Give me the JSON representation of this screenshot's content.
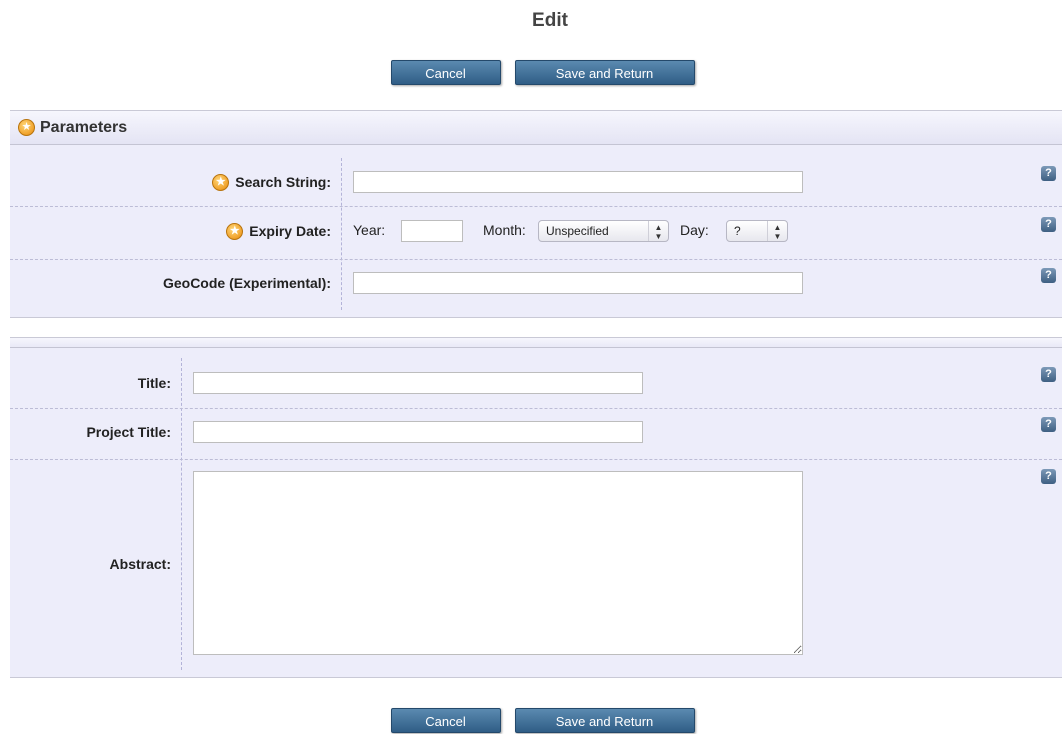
{
  "page": {
    "title": "Edit"
  },
  "buttons": {
    "cancel": "Cancel",
    "save": "Save and Return"
  },
  "parameters": {
    "header": "Parameters",
    "search_string": {
      "label": "Search String:",
      "value": ""
    },
    "expiry_date": {
      "label": "Expiry Date:",
      "year_label": "Year:",
      "year_value": "",
      "month_label": "Month:",
      "month_value": "Unspecified",
      "day_label": "Day:",
      "day_value": "?"
    },
    "geocode": {
      "label": "GeoCode (Experimental):",
      "value": ""
    }
  },
  "details": {
    "title": {
      "label": "Title:",
      "value": ""
    },
    "project_title": {
      "label": "Project Title:",
      "value": ""
    },
    "abstract": {
      "label": "Abstract:",
      "value": ""
    }
  },
  "help": {
    "glyph": "?"
  },
  "colors": {
    "panel_bg": "#ededfa",
    "button": "#3b6890",
    "star": "#f0a12a"
  }
}
